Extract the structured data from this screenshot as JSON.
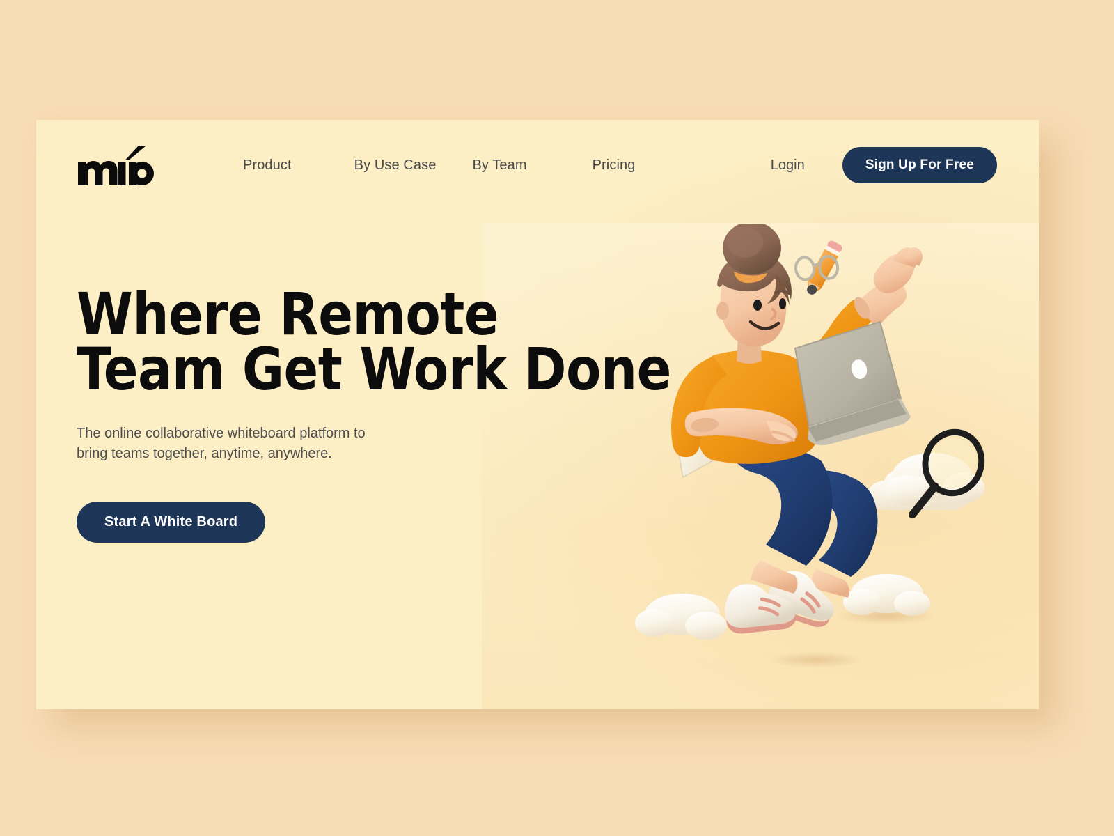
{
  "brand": {
    "logo_text": "miro",
    "logo_icon": "miro-wordmark"
  },
  "nav": {
    "links": [
      {
        "label": "Product"
      },
      {
        "label": "By Use Case"
      },
      {
        "label": "By Team"
      },
      {
        "label": "Pricing"
      }
    ],
    "login_label": "Login",
    "signup_label": "Sign Up For Free"
  },
  "hero": {
    "title": "Where Remote\nTeam Get Work Done",
    "subtitle": "The online collaborative whiteboard platform to\nbring teams together, anytime, anywhere.",
    "cta_label": "Start A White Board"
  },
  "illustration": {
    "name": "person-jumping-with-laptop",
    "elements": [
      "hair-bun",
      "eyeglasses",
      "pencil",
      "laptop",
      "orange-sweater",
      "navy-trousers",
      "white-sneakers",
      "open-book",
      "magnifying-glass",
      "cloud-left",
      "cloud-right",
      "cloud-bottom"
    ]
  },
  "colors": {
    "page_background": "#f8dcb4",
    "card_background": "#fcefc6",
    "accent_navy": "#1d3557",
    "text_primary": "#0c0c0c",
    "text_secondary": "#4d4d4d",
    "sweater_orange": "#f0981f",
    "trousers_navy": "#1f3b6e",
    "skin": "#f6c9a6",
    "hair_brown": "#8a6752",
    "cloud_white": "#fdfaf2",
    "shoe_sole_pink": "#e09a8a",
    "laptop_grey": "#b6b1a2"
  }
}
